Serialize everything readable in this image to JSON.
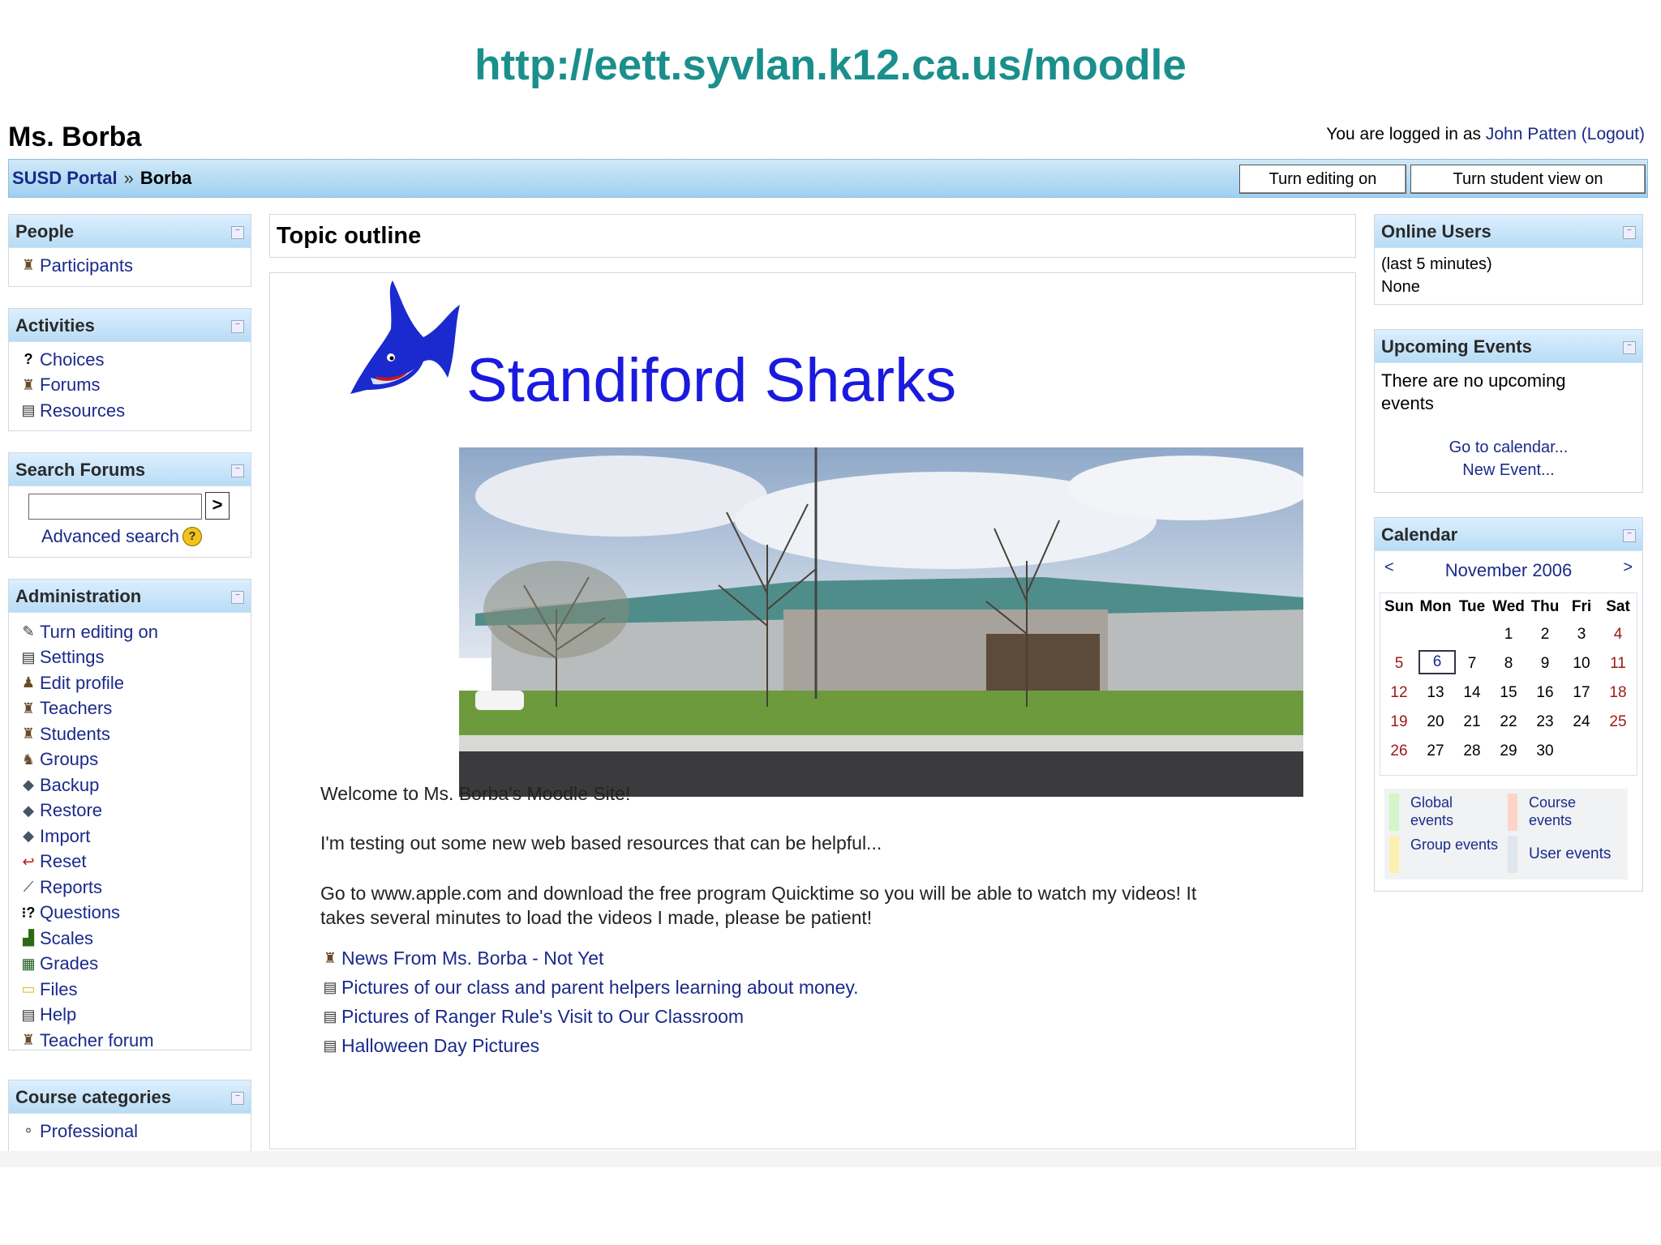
{
  "slide_url": "http://eett.syvlan.k12.ca.us/moodle",
  "header": {
    "site_name": "Ms. Borba",
    "login_prefix": "You are logged in as",
    "user_name": "John Patten",
    "logout": "(Logout)"
  },
  "navbar": {
    "portal": "SUSD Portal",
    "separator": "»",
    "current": "Borba",
    "btn_editing": "Turn editing on",
    "btn_student": "Turn student view on"
  },
  "left": {
    "people": {
      "title": "People",
      "items": [
        {
          "label": "Participants",
          "icon": "participants-icon"
        }
      ]
    },
    "activities": {
      "title": "Activities",
      "items": [
        {
          "label": "Choices",
          "icon": "choice-icon"
        },
        {
          "label": "Forums",
          "icon": "forum-icon"
        },
        {
          "label": "Resources",
          "icon": "resource-icon"
        }
      ]
    },
    "search_forums": {
      "title": "Search Forums",
      "go": ">",
      "advanced": "Advanced search",
      "help": "?"
    },
    "administration": {
      "title": "Administration",
      "items": [
        {
          "label": "Turn editing on",
          "icon": "edit-icon"
        },
        {
          "label": "Settings",
          "icon": "settings-icon"
        },
        {
          "label": "Edit profile",
          "icon": "profile-icon"
        },
        {
          "label": "Teachers",
          "icon": "teachers-icon"
        },
        {
          "label": "Students",
          "icon": "students-icon"
        },
        {
          "label": "Groups",
          "icon": "groups-icon"
        },
        {
          "label": "Backup",
          "icon": "backup-icon"
        },
        {
          "label": "Restore",
          "icon": "restore-icon"
        },
        {
          "label": "Import",
          "icon": "import-icon"
        },
        {
          "label": "Reset",
          "icon": "reset-icon"
        },
        {
          "label": "Reports",
          "icon": "reports-icon"
        },
        {
          "label": "Questions",
          "icon": "questions-icon"
        },
        {
          "label": "Scales",
          "icon": "scales-icon"
        },
        {
          "label": "Grades",
          "icon": "grades-icon"
        },
        {
          "label": "Files",
          "icon": "files-icon"
        },
        {
          "label": "Help",
          "icon": "help-icon"
        },
        {
          "label": "Teacher forum",
          "icon": "teacher-forum-icon"
        }
      ]
    },
    "course_categories": {
      "title": "Course categories",
      "items": [
        {
          "label": "Professional",
          "icon": "category-icon"
        }
      ]
    }
  },
  "main": {
    "title": "Topic outline",
    "banner_text": "Standiford Sharks",
    "welcome": "Welcome to Ms. Borba's Moodle Site!",
    "testing": "I'm testing out some new web based resources that can be helpful...",
    "quicktime_1": "Go to www.apple.com and download the free program Quicktime so you will be able to watch my videos!    It",
    "quicktime_2": "takes  several minutes to load the videos I made, please be patient!",
    "links": [
      {
        "label": "News From Ms. Borba - Not Yet",
        "icon": "forum-icon"
      },
      {
        "label": "Pictures of our class and parent helpers learning about money.",
        "icon": "web-page-icon"
      },
      {
        "label": "Pictures of Ranger Rule's Visit to Our Classroom",
        "icon": "web-page-icon"
      },
      {
        "label": "Halloween Day Pictures",
        "icon": "web-page-icon"
      }
    ]
  },
  "right": {
    "online_users": {
      "title": "Online Users",
      "period": "(last 5 minutes)",
      "none": "None"
    },
    "upcoming": {
      "title": "Upcoming Events",
      "none_1": "There are no upcoming",
      "none_2": "events",
      "go_calendar": "Go to calendar...",
      "new_event": "New Event..."
    },
    "calendar": {
      "title": "Calendar",
      "prev": "<",
      "next": ">",
      "month": "November 2006",
      "days": [
        "Sun",
        "Mon",
        "Tue",
        "Wed",
        "Thu",
        "Fri",
        "Sat"
      ],
      "weeks": [
        [
          "",
          "",
          "",
          "1",
          "2",
          "3",
          "4"
        ],
        [
          "5",
          "6",
          "7",
          "8",
          "9",
          "10",
          "11"
        ],
        [
          "12",
          "13",
          "14",
          "15",
          "16",
          "17",
          "18"
        ],
        [
          "19",
          "20",
          "21",
          "22",
          "23",
          "24",
          "25"
        ],
        [
          "26",
          "27",
          "28",
          "29",
          "30",
          "",
          ""
        ]
      ],
      "today": "6",
      "legend": {
        "global": "Global events",
        "course": "Course events",
        "group": "Group events",
        "user": "User events"
      }
    }
  },
  "colors": {
    "url_title": "#1a8f8c",
    "link": "#1a2a8a",
    "weekend": "#a01818",
    "banner_text": "#1a1adf"
  }
}
